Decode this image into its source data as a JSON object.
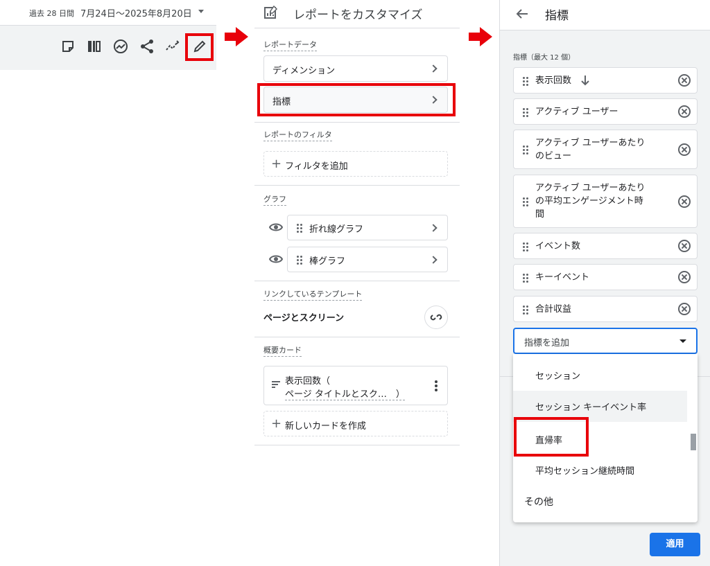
{
  "panel1": {
    "date_label": "過去 28 日間",
    "date_range": "7月24日～2025年8月20日",
    "toolbar_icons": [
      "note-icon",
      "compare-icon",
      "insights-icon",
      "share-icon",
      "trend-icon",
      "pencil-edit-icon"
    ]
  },
  "panel2": {
    "title": "レポートをカスタマイズ",
    "report_data_label": "レポートデータ",
    "dimension_label": "ディメンション",
    "metrics_label": "指標",
    "filter_section_label": "レポートのフィルタ",
    "add_filter_label": "フィルタを追加",
    "graph_section_label": "グラフ",
    "line_graph_label": "折れ線グラフ",
    "bar_graph_label": "棒グラフ",
    "linked_template_label": "リンクしているテンプレート",
    "template_name": "ページとスクリーン",
    "summary_card_label": "概要カード",
    "summary_card_line1": "表示回数（",
    "summary_card_line2": "ページ タイトルとスク…　）",
    "new_card_label": "新しいカードを作成"
  },
  "panel3": {
    "title": "指標",
    "metrics_caption": "指標（最大 12 個）",
    "metrics": [
      {
        "line1": "表示回数",
        "line2": "",
        "line3": ""
      },
      {
        "line1": "アクティブ ユーザー",
        "line2": "",
        "line3": ""
      },
      {
        "line1": "アクティブ ユーザーあたり",
        "line2": "のビュー",
        "line3": ""
      },
      {
        "line1": "アクティブ ユーザーあたり",
        "line2": "の平均エンゲージメント時",
        "line3": "間"
      },
      {
        "line1": "イベント数",
        "line2": "",
        "line3": ""
      },
      {
        "line1": "キーイベント",
        "line2": "",
        "line3": ""
      },
      {
        "line1": "合計収益",
        "line2": "",
        "line3": ""
      }
    ],
    "add_metric_placeholder": "指標を追加",
    "dropdown_options": [
      "セッション",
      "セッション キーイベント率",
      "直帰率",
      "平均セッション継続時間"
    ],
    "other_label": "その他",
    "apply_label": "適用"
  },
  "colors": {
    "highlight": "#e8000a",
    "accent": "#1a73e8"
  }
}
